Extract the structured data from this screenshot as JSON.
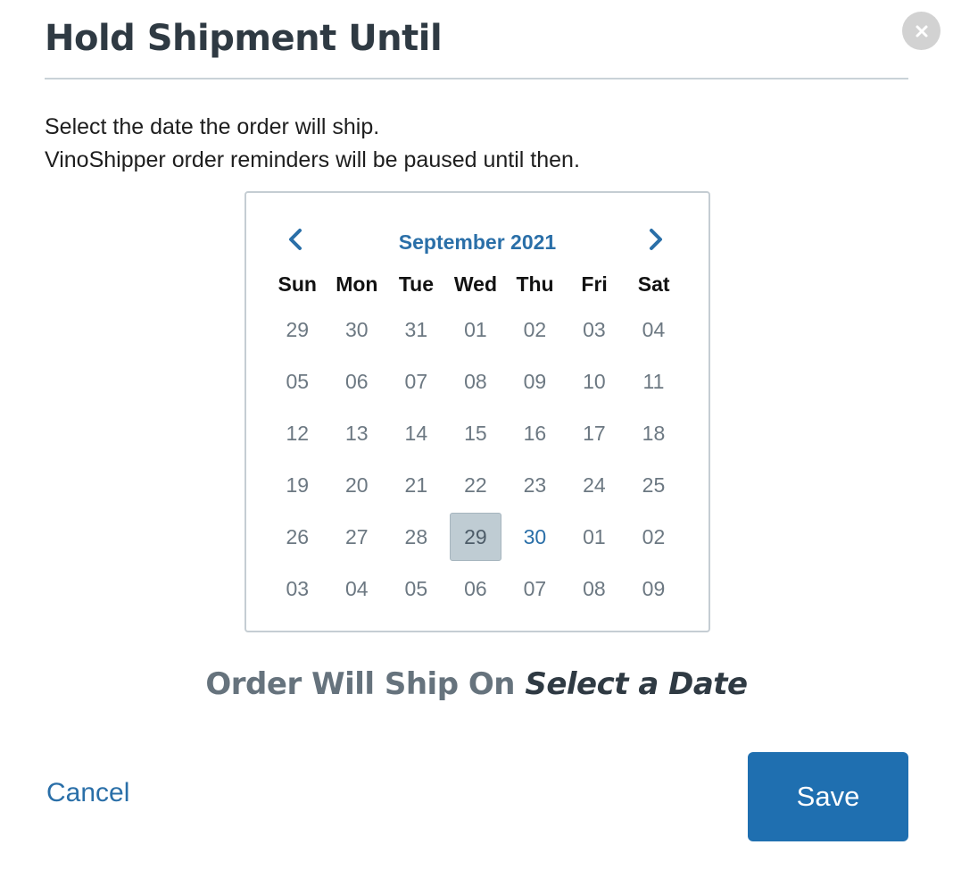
{
  "dialog": {
    "title": "Hold Shipment Until",
    "close_icon": "close-icon",
    "intro_line1": "Select the date the order will ship.",
    "intro_line2": "VinoShipper order reminders will be paused until then."
  },
  "calendar": {
    "month_label": "September 2021",
    "prev_icon": "chevron-left-icon",
    "next_icon": "chevron-right-icon",
    "weekdays": [
      "Sun",
      "Mon",
      "Tue",
      "Wed",
      "Thu",
      "Fri",
      "Sat"
    ],
    "weeks": [
      [
        "29",
        "30",
        "31",
        "01",
        "02",
        "03",
        "04"
      ],
      [
        "05",
        "06",
        "07",
        "08",
        "09",
        "10",
        "11"
      ],
      [
        "12",
        "13",
        "14",
        "15",
        "16",
        "17",
        "18"
      ],
      [
        "19",
        "20",
        "21",
        "22",
        "23",
        "24",
        "25"
      ],
      [
        "26",
        "27",
        "28",
        "29",
        "30",
        "01",
        "02"
      ],
      [
        "03",
        "04",
        "05",
        "06",
        "07",
        "08",
        "09"
      ]
    ],
    "highlighted_cell": {
      "week": 4,
      "day": 3,
      "value": "29"
    },
    "accent_cell": {
      "week": 4,
      "day": 4,
      "value": "30"
    }
  },
  "ship_on": {
    "label": "Order Will Ship On",
    "value": "Select a Date"
  },
  "footer": {
    "cancel_label": "Cancel",
    "save_label": "Save"
  },
  "colors": {
    "accent": "#2a6fa8",
    "save_button": "#1f6fb0",
    "selected_day_bg": "#bfccd3"
  }
}
